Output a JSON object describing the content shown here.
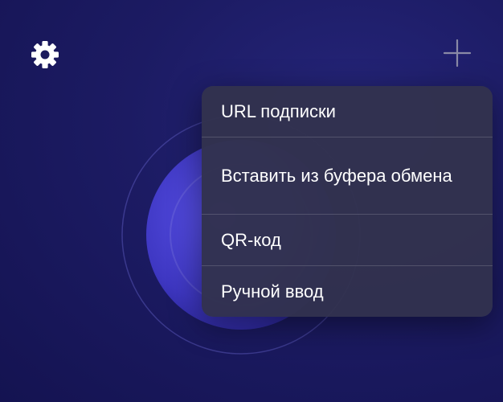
{
  "icons": {
    "settings": "gear-icon",
    "add": "plus-icon"
  },
  "colors": {
    "background": "#1c1b63",
    "menu_background": "#32324e",
    "accent": "#4a44d6",
    "text": "#ffffff"
  },
  "menu": {
    "items": [
      {
        "label": "URL подписки"
      },
      {
        "label": "Вставить из буфера обмена"
      },
      {
        "label": "QR-код"
      },
      {
        "label": "Ручной ввод"
      }
    ]
  }
}
